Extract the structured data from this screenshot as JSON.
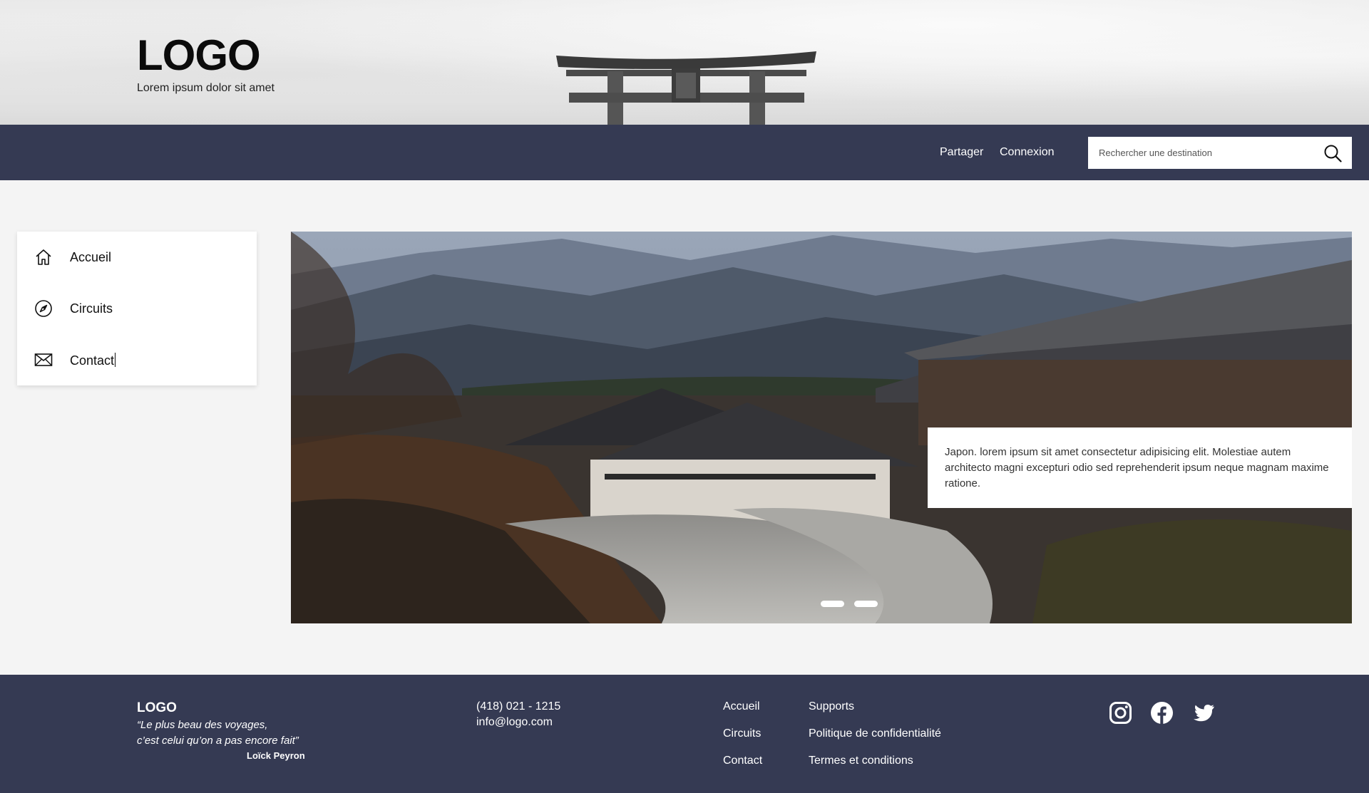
{
  "header": {
    "logo": "LOGO",
    "tagline": "Lorem ipsum dolor sit amet"
  },
  "nav": {
    "share_label": "Partager",
    "login_label": "Connexion",
    "search_placeholder": "Rechercher une destination",
    "search_icon": "search-icon"
  },
  "sidebar": {
    "items": [
      {
        "label": "Accueil",
        "icon": "home-icon"
      },
      {
        "label": "Circuits",
        "icon": "compass-icon"
      },
      {
        "label": "Contact",
        "icon": "envelope-icon"
      }
    ]
  },
  "hero": {
    "caption": "Japon. lorem ipsum sit amet consectetur adipisicing elit. Molestiae autem architecto magni excepturi odio sed reprehenderit ipsum neque magnam maxime ratione.",
    "slide_count": 2
  },
  "footer": {
    "logo": "LOGO",
    "quote_line1": "“Le plus beau des voyages,",
    "quote_line2": "c’est celui qu’on a pas encore fait”",
    "quote_author": "Loïck Peyron",
    "phone": "(418) 021 - 1215",
    "email": "info@logo.com",
    "links_col1": [
      "Accueil",
      "Circuits",
      "Contact"
    ],
    "links_col2": [
      "Supports",
      "Politique de confidentialité",
      "Termes et conditions"
    ],
    "social": [
      "instagram-icon",
      "facebook-icon",
      "twitter-icon"
    ]
  },
  "colors": {
    "navbar": "#353a53",
    "footer": "#353a53",
    "page_background": "#f4f4f4"
  }
}
